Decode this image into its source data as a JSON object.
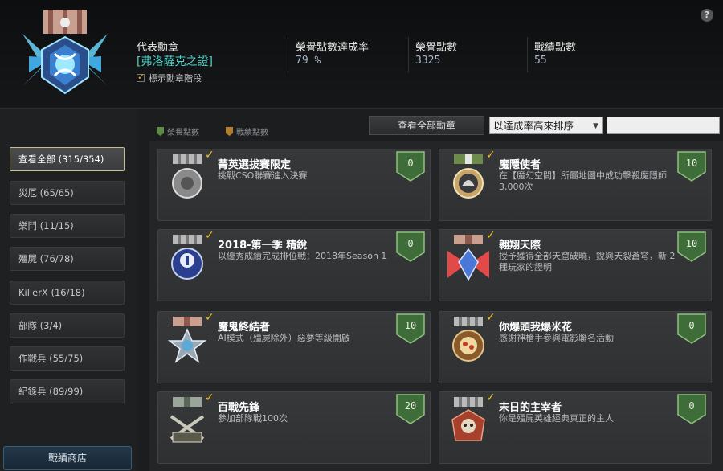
{
  "header": {
    "rep_medal_label": "代表勳章",
    "rep_medal_name": "[弗洛薩克之證]",
    "show_tier_label": "標示勳章階段",
    "rate_label": "榮譽點數達成率",
    "rate_value": "79 %",
    "honor_label": "榮譽點數",
    "honor_value": "3325",
    "merit_label": "戰績點數",
    "merit_value": "55",
    "help_icon": "?"
  },
  "sidebar": {
    "items": [
      {
        "label": "查看全部 (315/354)"
      },
      {
        "label": "災厄 (65/65)"
      },
      {
        "label": "樂鬥 (11/15)"
      },
      {
        "label": "殭屍 (76/78)"
      },
      {
        "label": "KillerX (16/18)"
      },
      {
        "label": "部隊 (3/4)"
      },
      {
        "label": "作戰兵 (55/75)"
      },
      {
        "label": "紀錄兵 (89/99)"
      }
    ],
    "shop_label": "戰績商店"
  },
  "toolbar": {
    "legend_honor": "榮譽點數",
    "legend_merit": "戰績點數",
    "view_all_label": "查看全部勳章",
    "sort_value": "以達成率高來排序",
    "search_value": ""
  },
  "medals": [
    {
      "title": "菁英選拔賽限定",
      "desc": "挑戰CSO聯賽進入決賽",
      "points": "0",
      "icon": "gear-medal-icon"
    },
    {
      "title": "魔隱使者",
      "desc": "在【魔幻空間】所屬地圖中成功擊殺魔隱師3,000次",
      "points": "10",
      "icon": "eagle-medal-icon"
    },
    {
      "title": "2018-第一季 精銳",
      "desc": "以優秀成績完成排位戰：2018年Season 1",
      "points": "0",
      "icon": "season-2018-medal-icon"
    },
    {
      "title": "翱翔天際",
      "desc": "授予獲得全部天窟破曉，銳與天裂蒼穹，斬 2種玩家的證明",
      "points": "10",
      "icon": "wing-medal-icon"
    },
    {
      "title": "魔鬼終結者",
      "desc": "AI模式（殭屍除外）惡夢等級開啟",
      "points": "10",
      "icon": "star-medal-icon"
    },
    {
      "title": "你爆頭我爆米花",
      "desc": "感謝神槍手參與電影聯名活動",
      "points": "0",
      "icon": "popcorn-medal-icon"
    },
    {
      "title": "百戰先鋒",
      "desc": "參加部隊戰100次",
      "points": "20",
      "icon": "100th-medal-icon"
    },
    {
      "title": "末日的主宰者",
      "desc": "你是殭屍英雄經典真正的主人",
      "points": "0",
      "icon": "skull-medal-icon"
    }
  ],
  "colors": {
    "accent_teal": "#4fd2c8",
    "badge_green": "#3f6d3a",
    "checkmark_gold": "#f0c020"
  }
}
